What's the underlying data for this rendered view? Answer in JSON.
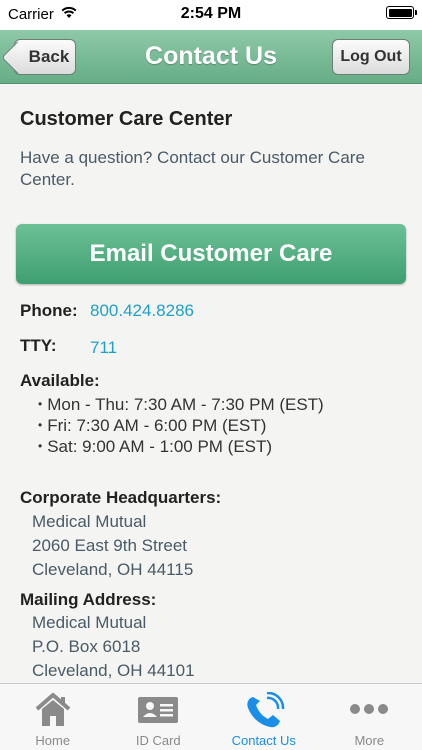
{
  "status_bar": {
    "carrier": "Carrier",
    "time": "2:54 PM"
  },
  "nav": {
    "title": "Contact Us",
    "back_label": "Back",
    "logout_label": "Log Out"
  },
  "content": {
    "section_title": "Customer Care Center",
    "intro": "Have a question? Contact our Customer Care Center.",
    "email_button": "Email Customer Care",
    "phone_label": "Phone:",
    "phone_value": "800.424.8286",
    "tty_label": "TTY:",
    "tty_value": "711",
    "available_label": "Available:",
    "hours": [
      "Mon - Thu: 7:30 AM - 7:30 PM (EST)",
      "Fri: 7:30 AM - 6:00 PM (EST)",
      "Sat: 9:00 AM - 1:00 PM (EST)"
    ],
    "hq_label": "Corporate Headquarters:",
    "hq_lines": [
      "Medical Mutual",
      "2060 East 9th Street",
      "Cleveland, OH 44115"
    ],
    "mailing_label": "Mailing Address:",
    "mailing_lines": [
      "Medical Mutual",
      "P.O. Box 6018",
      "Cleveland, OH 44101"
    ]
  },
  "tabs": [
    {
      "label": "Home",
      "icon": "home-icon",
      "active": false
    },
    {
      "label": "ID Card",
      "icon": "id-card-icon",
      "active": false
    },
    {
      "label": "Contact Us",
      "icon": "phone-icon",
      "active": true
    },
    {
      "label": "More",
      "icon": "more-icon",
      "active": false
    }
  ],
  "colors": {
    "nav_green": "#66ad86",
    "button_green": "#3f9f70",
    "link_blue": "#1ea0c9",
    "tab_active": "#1a8ee6",
    "tab_inactive": "#8a8a8a"
  }
}
